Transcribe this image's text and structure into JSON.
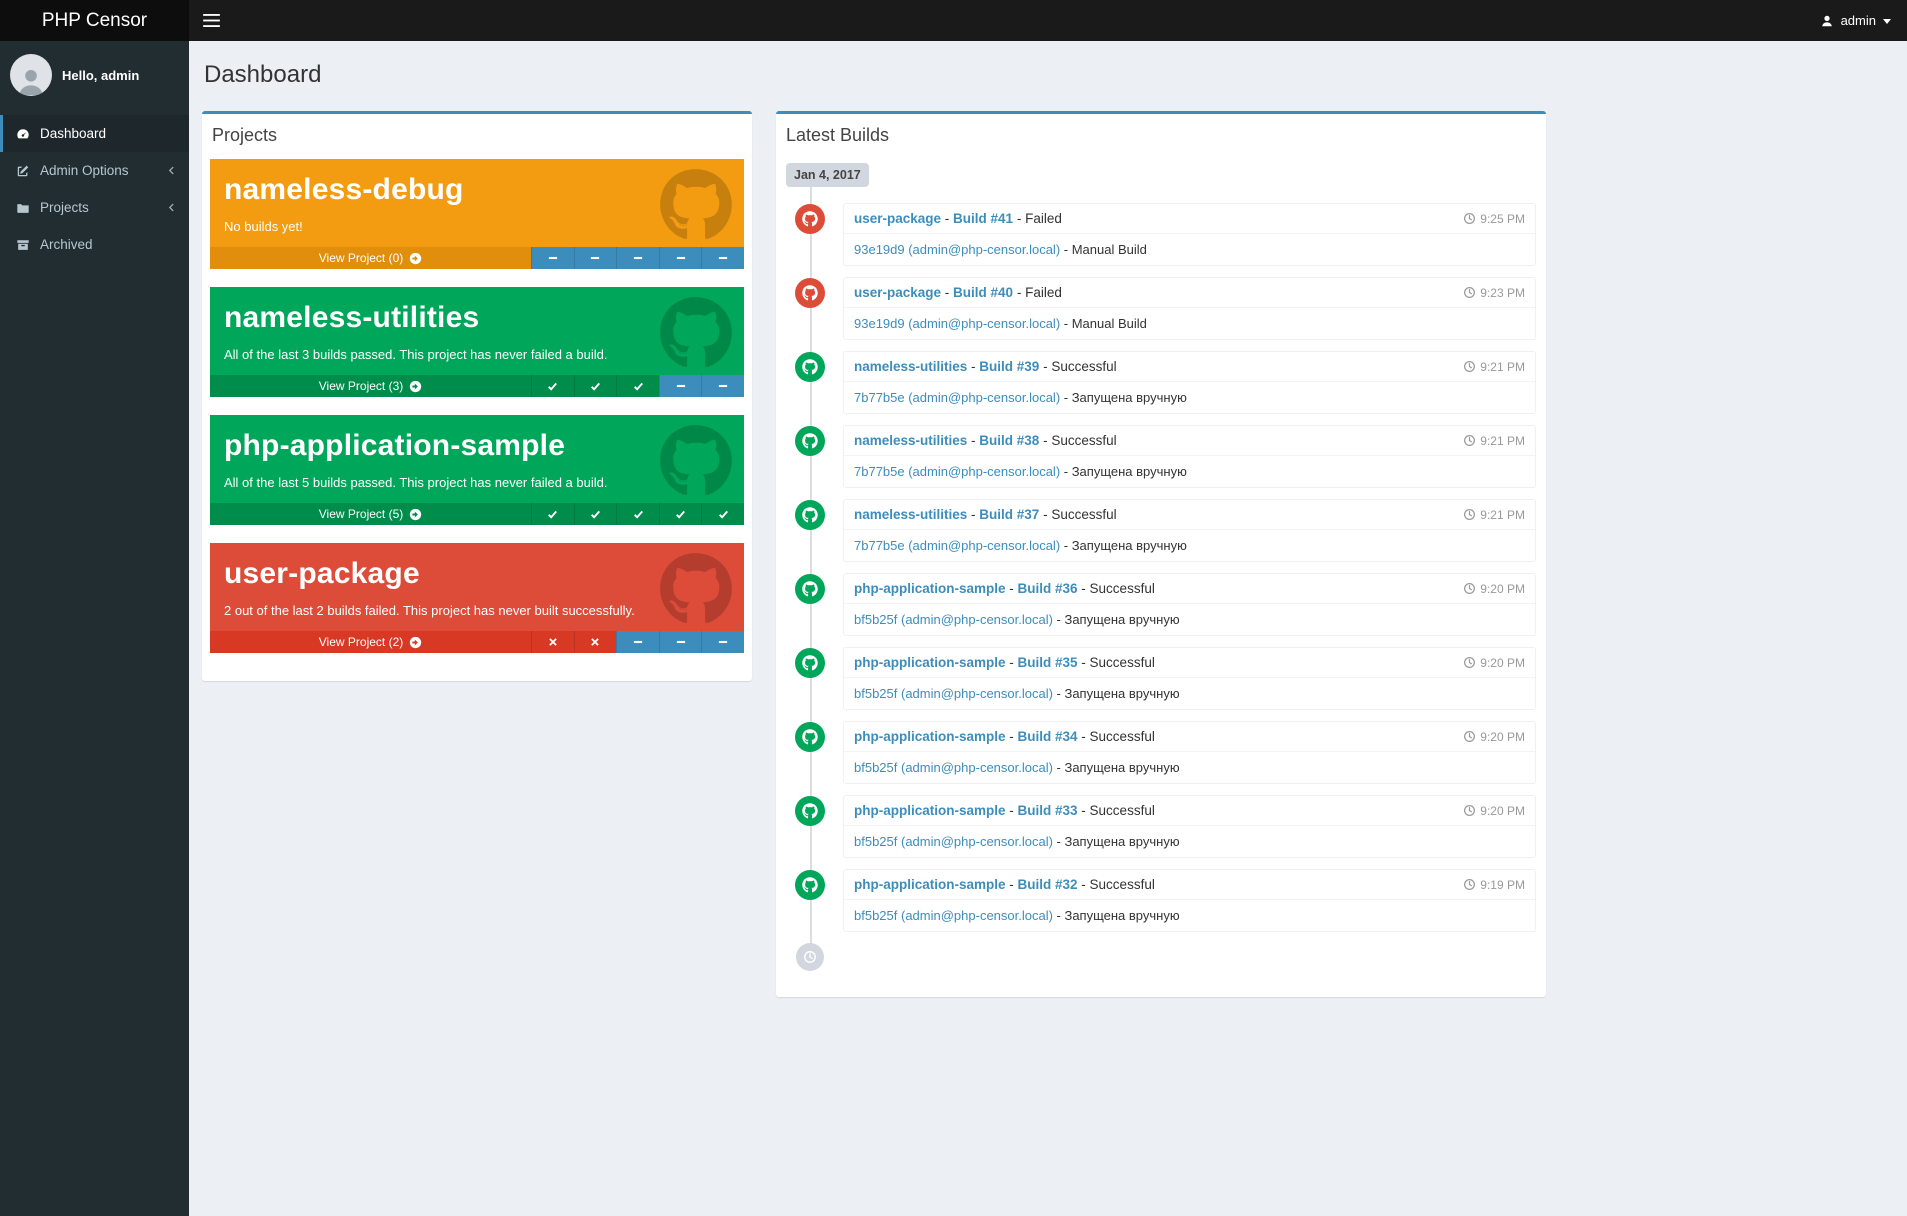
{
  "app": {
    "brand": "PHP Censor",
    "user_label": "admin",
    "greeting": "Hello, admin"
  },
  "colors": {
    "accent": "#3c8dbc",
    "success": "#00a65a",
    "failed": "#dd4b39",
    "pending": "#3c8dbc"
  },
  "page": {
    "title": "Dashboard"
  },
  "sidebar": {
    "items": [
      {
        "label": "Dashboard",
        "icon": "dashboard-icon",
        "active": true,
        "has_submenu": false
      },
      {
        "label": "Admin Options",
        "icon": "edit-icon",
        "active": false,
        "has_submenu": true
      },
      {
        "label": "Projects",
        "icon": "folder-icon",
        "active": false,
        "has_submenu": true
      },
      {
        "label": "Archived",
        "icon": "archive-icon",
        "active": false,
        "has_submenu": false
      }
    ]
  },
  "projects_panel": {
    "title": "Projects",
    "projects": [
      {
        "name": "nameless-debug",
        "summary": "No builds yet!",
        "view_label": "View Project (0)",
        "color": "#f39c12",
        "color_dark": "#e08e0b",
        "statuses": [
          "pending",
          "pending",
          "pending",
          "pending",
          "pending"
        ]
      },
      {
        "name": "nameless-utilities",
        "summary": "All of the last 3 builds passed. This project has never failed a build.",
        "view_label": "View Project (3)",
        "color": "#00a65a",
        "color_dark": "#008d4c",
        "statuses": [
          "success",
          "success",
          "success",
          "pending",
          "pending"
        ]
      },
      {
        "name": "php-application-sample",
        "summary": "All of the last 5 builds passed. This project has never failed a build.",
        "view_label": "View Project (5)",
        "color": "#00a65a",
        "color_dark": "#008d4c",
        "statuses": [
          "success",
          "success",
          "success",
          "success",
          "success"
        ]
      },
      {
        "name": "user-package",
        "summary": "2 out of the last 2 builds failed. This project has never built successfully.",
        "view_label": "View Project (2)",
        "color": "#dd4b39",
        "color_dark": "#d73925",
        "statuses": [
          "failed",
          "failed",
          "pending",
          "pending",
          "pending"
        ]
      }
    ]
  },
  "builds_panel": {
    "title": "Latest Builds",
    "date_label": "Jan 4, 2017",
    "builds": [
      {
        "project": "user-package",
        "build": "Build #41",
        "status": "Failed",
        "result": "failed",
        "time": "9:25 PM",
        "commit": "93e19d9 (admin@php-censor.local)",
        "note": "Manual Build"
      },
      {
        "project": "user-package",
        "build": "Build #40",
        "status": "Failed",
        "result": "failed",
        "time": "9:23 PM",
        "commit": "93e19d9 (admin@php-censor.local)",
        "note": "Manual Build"
      },
      {
        "project": "nameless-utilities",
        "build": "Build #39",
        "status": "Successful",
        "result": "success",
        "time": "9:21 PM",
        "commit": "7b77b5e (admin@php-censor.local)",
        "note": "Запущена вручную"
      },
      {
        "project": "nameless-utilities",
        "build": "Build #38",
        "status": "Successful",
        "result": "success",
        "time": "9:21 PM",
        "commit": "7b77b5e (admin@php-censor.local)",
        "note": "Запущена вручную"
      },
      {
        "project": "nameless-utilities",
        "build": "Build #37",
        "status": "Successful",
        "result": "success",
        "time": "9:21 PM",
        "commit": "7b77b5e (admin@php-censor.local)",
        "note": "Запущена вручную"
      },
      {
        "project": "php-application-sample",
        "build": "Build #36",
        "status": "Successful",
        "result": "success",
        "time": "9:20 PM",
        "commit": "bf5b25f (admin@php-censor.local)",
        "note": "Запущена вручную"
      },
      {
        "project": "php-application-sample",
        "build": "Build #35",
        "status": "Successful",
        "result": "success",
        "time": "9:20 PM",
        "commit": "bf5b25f (admin@php-censor.local)",
        "note": "Запущена вручную"
      },
      {
        "project": "php-application-sample",
        "build": "Build #34",
        "status": "Successful",
        "result": "success",
        "time": "9:20 PM",
        "commit": "bf5b25f (admin@php-censor.local)",
        "note": "Запущена вручную"
      },
      {
        "project": "php-application-sample",
        "build": "Build #33",
        "status": "Successful",
        "result": "success",
        "time": "9:20 PM",
        "commit": "bf5b25f (admin@php-censor.local)",
        "note": "Запущена вручную"
      },
      {
        "project": "php-application-sample",
        "build": "Build #32",
        "status": "Successful",
        "result": "success",
        "time": "9:19 PM",
        "commit": "bf5b25f (admin@php-censor.local)",
        "note": "Запущена вручную"
      }
    ]
  }
}
